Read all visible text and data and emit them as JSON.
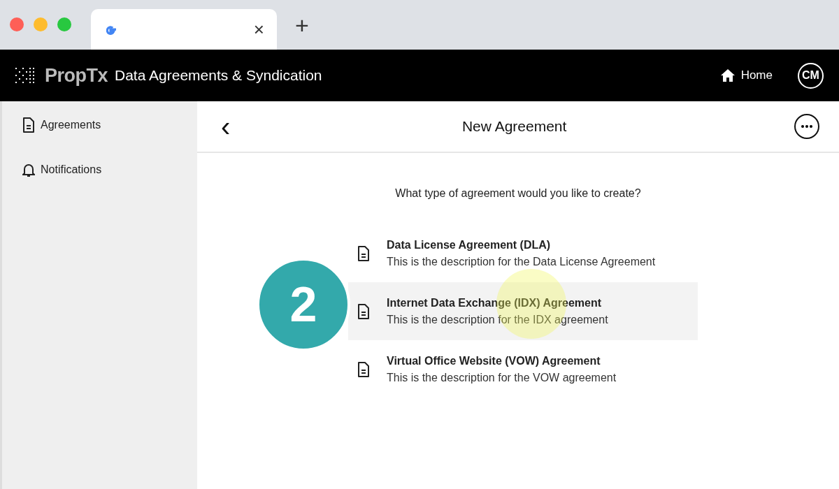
{
  "browser": {
    "tab": {
      "close": "×"
    },
    "new_tab": "+"
  },
  "header": {
    "logo": "PropTx",
    "title": "Data Agreements & Syndication",
    "home": "Home",
    "avatar": "CM"
  },
  "sidebar": {
    "items": [
      {
        "label": "Agreements",
        "kind": "document"
      },
      {
        "label": "Notifications",
        "kind": "bell"
      }
    ]
  },
  "page": {
    "title": "New Agreement",
    "back": "‹",
    "prompt": "What type of agreement would you like to create?",
    "options": [
      {
        "title": "Data License Agreement (DLA)",
        "description": "This is the description for the Data License Agreement",
        "selected": false
      },
      {
        "title": "Internet Data Exchange (IDX) Agreement",
        "description": "This is the description for the IDX agreement",
        "selected": true
      },
      {
        "title": "Virtual Office Website (VOW) Agreement",
        "description": "This is the description for the VOW agreement",
        "selected": false
      }
    ]
  },
  "step_badge": "2"
}
